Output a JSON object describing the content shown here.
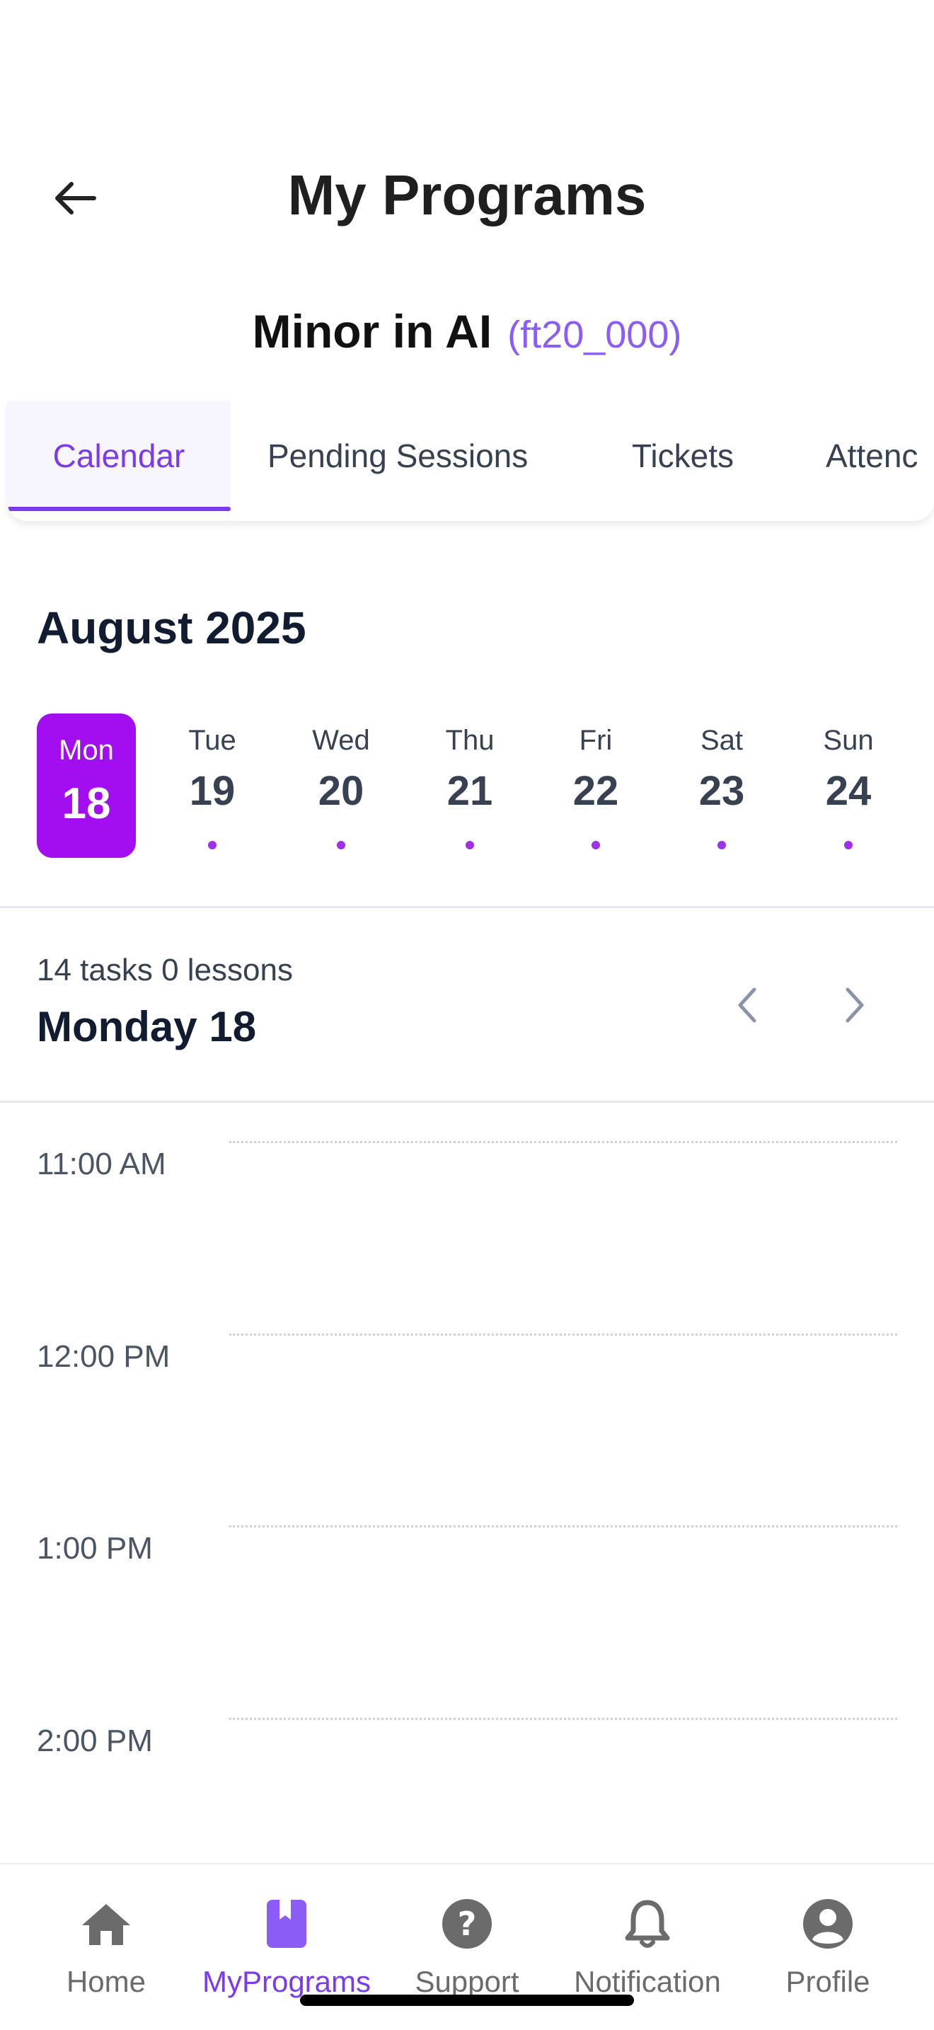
{
  "header": {
    "title": "My Programs",
    "program_name": "Minor in AI",
    "program_code": "(ft20_000)"
  },
  "tabs": [
    {
      "label": "Calendar",
      "active": true
    },
    {
      "label": "Pending Sessions",
      "active": false
    },
    {
      "label": "Tickets",
      "active": false
    },
    {
      "label": "Attenc",
      "active": false
    }
  ],
  "calendar": {
    "month": "August 2025",
    "days": [
      {
        "name": "Mon",
        "num": "18",
        "selected": true,
        "has_dot": false
      },
      {
        "name": "Tue",
        "num": "19",
        "selected": false,
        "has_dot": true
      },
      {
        "name": "Wed",
        "num": "20",
        "selected": false,
        "has_dot": true
      },
      {
        "name": "Thu",
        "num": "21",
        "selected": false,
        "has_dot": true
      },
      {
        "name": "Fri",
        "num": "22",
        "selected": false,
        "has_dot": true
      },
      {
        "name": "Sat",
        "num": "23",
        "selected": false,
        "has_dot": true
      },
      {
        "name": "Sun",
        "num": "24",
        "selected": false,
        "has_dot": true
      }
    ],
    "summary": "14 tasks 0 lessons",
    "selected_day": "Monday 18",
    "times": [
      "11:00 AM",
      "12:00 PM",
      "1:00 PM",
      "2:00 PM"
    ]
  },
  "bottom_nav": [
    {
      "label": "Home",
      "icon": "home-icon",
      "active": false
    },
    {
      "label": "MyPrograms",
      "icon": "book-icon",
      "active": true
    },
    {
      "label": "Support",
      "icon": "help-icon",
      "active": false
    },
    {
      "label": "Notification",
      "icon": "bell-icon",
      "active": false
    },
    {
      "label": "Profile",
      "icon": "profile-icon",
      "active": false
    }
  ],
  "colors": {
    "accent": "#7c3aed",
    "selected_day": "#a30ef0",
    "dot": "#a030e8"
  }
}
